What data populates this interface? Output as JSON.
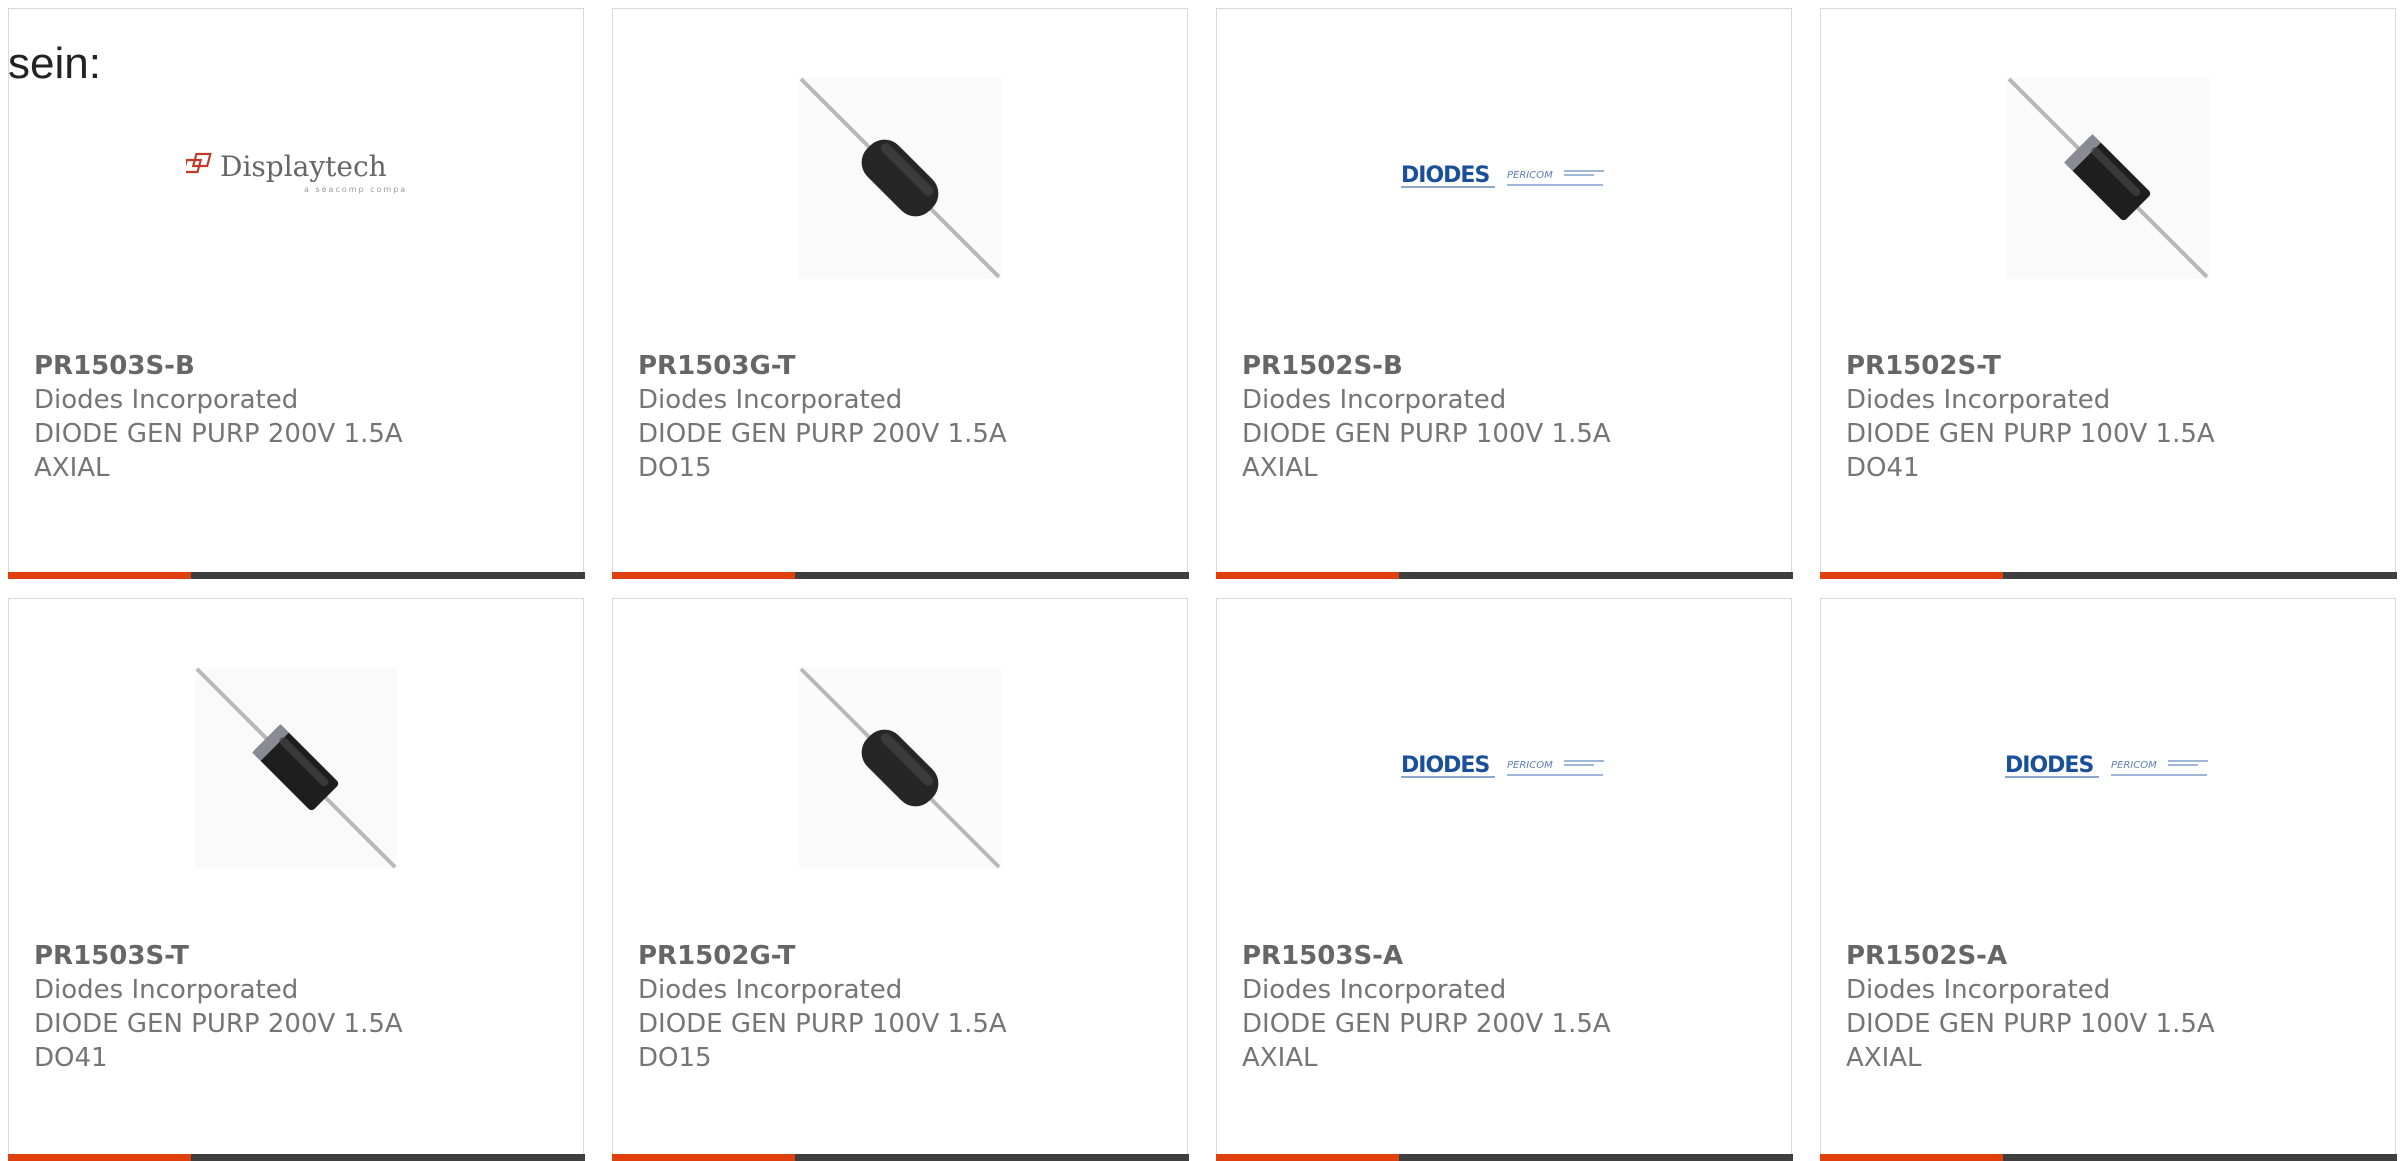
{
  "intro_text": "sein:",
  "colors": {
    "accent_bar": "#e0400e",
    "dark_bar": "#3f3f3f",
    "card_border": "#d9d9d9",
    "text": "#757575"
  },
  "products": [
    {
      "part_number": "PR1503S-B",
      "manufacturer": "Diodes Incorporated",
      "description": "DIODE GEN PURP 200V 1.5A",
      "package": "AXIAL",
      "image": "displaytech-logo",
      "logo_text": "Displaytech",
      "logo_subtext": "a seacomp company"
    },
    {
      "part_number": "PR1503G-T",
      "manufacturer": "Diodes Incorporated",
      "description": "DIODE GEN PURP 200V 1.5A",
      "package": "DO15",
      "image": "diode-dark"
    },
    {
      "part_number": "PR1502S-B",
      "manufacturer": "Diodes Incorporated",
      "description": "DIODE GEN PURP 100V 1.5A",
      "package": "AXIAL",
      "image": "diodes-pericom-logo",
      "logo_text": "DIODES",
      "logo_subtext": "PERICOM"
    },
    {
      "part_number": "PR1502S-T",
      "manufacturer": "Diodes Incorporated",
      "description": "DIODE GEN PURP 100V 1.5A",
      "package": "DO41",
      "image": "diode-banded"
    },
    {
      "part_number": "PR1503S-T",
      "manufacturer": "Diodes Incorporated",
      "description": "DIODE GEN PURP 200V 1.5A",
      "package": "DO41",
      "image": "diode-banded"
    },
    {
      "part_number": "PR1502G-T",
      "manufacturer": "Diodes Incorporated",
      "description": "DIODE GEN PURP 100V 1.5A",
      "package": "DO15",
      "image": "diode-dark"
    },
    {
      "part_number": "PR1503S-A",
      "manufacturer": "Diodes Incorporated",
      "description": "DIODE GEN PURP 200V 1.5A",
      "package": "AXIAL",
      "image": "diodes-pericom-logo",
      "logo_text": "DIODES",
      "logo_subtext": "PERICOM"
    },
    {
      "part_number": "PR1502S-A",
      "manufacturer": "Diodes Incorporated",
      "description": "DIODE GEN PURP 100V 1.5A",
      "package": "AXIAL",
      "image": "diodes-pericom-logo",
      "logo_text": "DIODES",
      "logo_subtext": "PERICOM"
    }
  ]
}
